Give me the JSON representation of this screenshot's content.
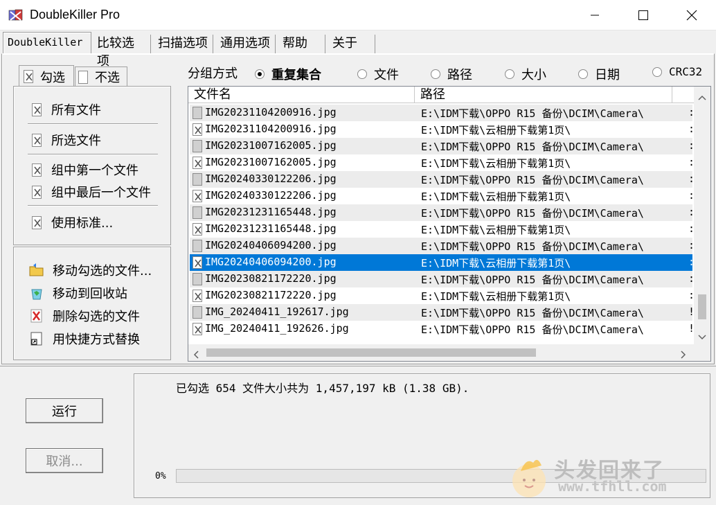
{
  "window": {
    "title": "DoubleKiller Pro"
  },
  "tabs": [
    "DoubleKiller",
    "比较选项",
    "扫描选项",
    "通用选项",
    "帮助",
    "关于"
  ],
  "select_panel": {
    "tab_check": "勾选",
    "tab_uncheck": "不选",
    "items": [
      "所有文件",
      "所选文件",
      "组中第一个文件",
      "组中最后一个文件",
      "使用标准..."
    ]
  },
  "actions": [
    {
      "label": "移动勾选的文件...",
      "icon": "folder-move-icon"
    },
    {
      "label": "移动到回收站",
      "icon": "recycle-bin-icon"
    },
    {
      "label": "删除勾选的文件",
      "icon": "delete-x-icon"
    },
    {
      "label": "用快捷方式替换",
      "icon": "shortcut-icon"
    }
  ],
  "grouping": {
    "label": "分组方式",
    "options": [
      "重复集合",
      "文件",
      "路径",
      "大小",
      "日期",
      "CRC32"
    ],
    "selected": "重复集合"
  },
  "file_list": {
    "columns": [
      "文件名",
      "路径"
    ],
    "rows": [
      {
        "name": "IMG20231104200916.jpg",
        "path": "E:\\IDM下载\\OPPO R15 备份\\DCIM\\Camera\\",
        "checked": false,
        "more": ":"
      },
      {
        "name": "IMG20231104200916.jpg",
        "path": "E:\\IDM下载\\云相册下载第1页\\",
        "checked": true,
        "more": ":"
      },
      {
        "name": "IMG20231007162005.jpg",
        "path": "E:\\IDM下载\\OPPO R15 备份\\DCIM\\Camera\\",
        "checked": false,
        "more": ":"
      },
      {
        "name": "IMG20231007162005.jpg",
        "path": "E:\\IDM下载\\云相册下载第1页\\",
        "checked": true,
        "more": ":"
      },
      {
        "name": "IMG20240330122206.jpg",
        "path": "E:\\IDM下载\\OPPO R15 备份\\DCIM\\Camera\\",
        "checked": false,
        "more": ":"
      },
      {
        "name": "IMG20240330122206.jpg",
        "path": "E:\\IDM下载\\云相册下载第1页\\",
        "checked": true,
        "more": ":"
      },
      {
        "name": "IMG20231231165448.jpg",
        "path": "E:\\IDM下载\\OPPO R15 备份\\DCIM\\Camera\\",
        "checked": false,
        "more": ":"
      },
      {
        "name": "IMG20231231165448.jpg",
        "path": "E:\\IDM下载\\云相册下载第1页\\",
        "checked": true,
        "more": ":"
      },
      {
        "name": "IMG20240406094200.jpg",
        "path": "E:\\IDM下载\\OPPO R15 备份\\DCIM\\Camera\\",
        "checked": false,
        "more": ":"
      },
      {
        "name": "IMG20240406094200.jpg",
        "path": "E:\\IDM下载\\云相册下载第1页\\",
        "checked": true,
        "more": ":"
      },
      {
        "name": "IMG20230821172220.jpg",
        "path": "E:\\IDM下载\\OPPO R15 备份\\DCIM\\Camera\\",
        "checked": false,
        "more": ":"
      },
      {
        "name": "IMG20230821172220.jpg",
        "path": "E:\\IDM下载\\云相册下载第1页\\",
        "checked": true,
        "more": ":"
      },
      {
        "name": "IMG_20240411_192617.jpg",
        "path": "E:\\IDM下载\\OPPO R15 备份\\DCIM\\Camera\\",
        "checked": false,
        "more": "!"
      },
      {
        "name": "IMG_20240411_192626.jpg",
        "path": "E:\\IDM下载\\OPPO R15 备份\\DCIM\\Camera\\",
        "checked": true,
        "more": "!"
      }
    ],
    "selected_row": 9
  },
  "buttons": {
    "run": "运行",
    "cancel": "取消..."
  },
  "status": {
    "text": "已勾选 654 文件大小共为 1,457,197 kB (1.38 GB).",
    "progress_label": "0%",
    "progress_value": 0
  },
  "watermark": {
    "text": "头发回来了",
    "url": "www.tfhll.com"
  },
  "colors": {
    "selection": "#0078d7",
    "window_bg": "#f0f0f0"
  }
}
